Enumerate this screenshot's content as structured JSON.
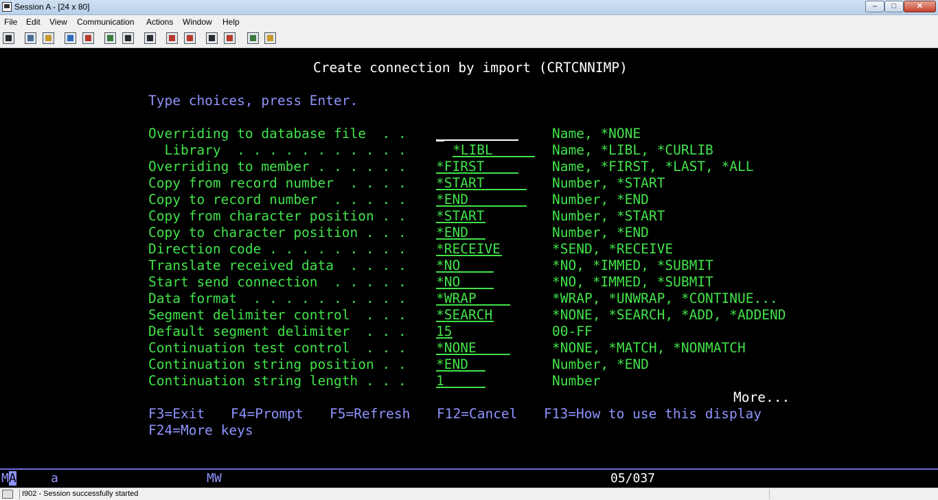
{
  "window": {
    "title": "Session A - [24 x 80]"
  },
  "menu": [
    "File",
    "Edit",
    "View",
    "Communication",
    "Actions",
    "Window",
    "Help"
  ],
  "toolbar_icons": [
    "print-icon",
    "copy-icon",
    "paste-icon",
    "send-icon",
    "receive-icon",
    "display-icon",
    "keypad-icon",
    "macro-icon",
    "record-icon",
    "play-icon",
    "stop-icon",
    "edit-icon",
    "connect-icon",
    "disconnect-icon",
    "globe-icon",
    "customize-icon"
  ],
  "screen": {
    "title": "Create connection by import (CRTCNNIMP)",
    "instruction": "Type choices, press Enter.",
    "params": [
      {
        "label": "Overriding to database file  . .",
        "value": "",
        "hint": "Name, *NONE"
      },
      {
        "label": "  Library  . . . . . . . . . . .",
        "value": "*LIBL",
        "hint": "Name, *LIBL, *CURLIB"
      },
      {
        "label": "Overriding to member . . . . . .",
        "value": "*FIRST",
        "hint": "Name, *FIRST, *LAST, *ALL"
      },
      {
        "label": "Copy from record number  . . . .",
        "value": "*START",
        "hint": "Number, *START"
      },
      {
        "label": "Copy to record number  . . . . .",
        "value": "*END",
        "hint": "Number, *END"
      },
      {
        "label": "Copy from character position . .",
        "value": "*START",
        "hint": "Number, *START"
      },
      {
        "label": "Copy to character position . . .",
        "value": "*END",
        "hint": "Number, *END"
      },
      {
        "label": "Direction code . . . . . . . . .",
        "value": "*RECEIVE",
        "hint": "*SEND, *RECEIVE"
      },
      {
        "label": "Translate received data  . . . .",
        "value": "*NO",
        "hint": "*NO, *IMMED, *SUBMIT"
      },
      {
        "label": "Start send connection  . . . . .",
        "value": "*NO",
        "hint": "*NO, *IMMED, *SUBMIT"
      },
      {
        "label": "Data format  . . . . . . . . . .",
        "value": "*WRAP",
        "hint": "*WRAP, *UNWRAP, *CONTINUE..."
      },
      {
        "label": "Segment delimiter control  . . .",
        "value": "*SEARCH",
        "hint": "*NONE, *SEARCH, *ADD, *ADDEND"
      },
      {
        "label": "Default segment delimiter  . . .",
        "value": "15",
        "hint": "00-FF"
      },
      {
        "label": "Continuation test control  . . .",
        "value": "*NONE",
        "hint": "*NONE, *MATCH, *NONMATCH"
      },
      {
        "label": "Continuation string position . .",
        "value": "*END",
        "hint": "Number, *END"
      },
      {
        "label": "Continuation string length . . .",
        "value": "1",
        "hint": "Number"
      }
    ],
    "more": "More...",
    "fkeys_line1": [
      "F3=Exit",
      "F4=Prompt",
      "F5=Refresh",
      "F12=Cancel",
      "F13=How to use this display"
    ],
    "fkeys_line2": "F24=More keys"
  },
  "oia": {
    "mode_prefix": "M",
    "mode_highlight": "A",
    "shift": "a",
    "session_type": "MW",
    "cursor_pos": "05/037"
  },
  "status": {
    "message": "I902 - Session successfully started"
  }
}
